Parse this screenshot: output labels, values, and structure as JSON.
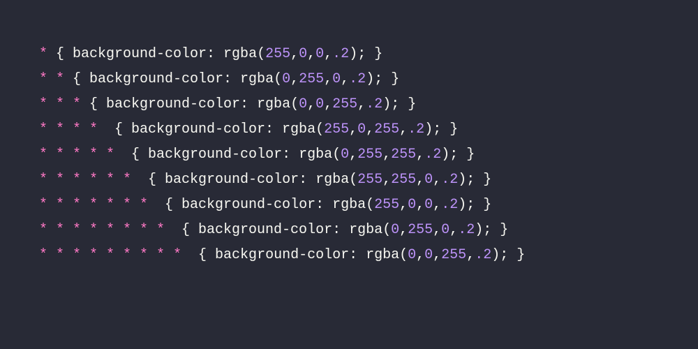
{
  "lines": [
    {
      "selector": "*",
      "property": "background-color",
      "func": "rgba",
      "args": [
        "255",
        "0",
        "0",
        ".2"
      ]
    },
    {
      "selector": "* *",
      "property": "background-color",
      "func": "rgba",
      "args": [
        "0",
        "255",
        "0",
        ".2"
      ]
    },
    {
      "selector": "* * *",
      "property": "background-color",
      "func": "rgba",
      "args": [
        "0",
        "0",
        "255",
        ".2"
      ]
    },
    {
      "selector": "* * * * ",
      "property": "background-color",
      "func": "rgba",
      "args": [
        "255",
        "0",
        "255",
        ".2"
      ]
    },
    {
      "selector": "* * * * * ",
      "property": "background-color",
      "func": "rgba",
      "args": [
        "0",
        "255",
        "255",
        ".2"
      ]
    },
    {
      "selector": "* * * * * * ",
      "property": "background-color",
      "func": "rgba",
      "args": [
        "255",
        "255",
        "0",
        ".2"
      ]
    },
    {
      "selector": "* * * * * * * ",
      "property": "background-color",
      "func": "rgba",
      "args": [
        "255",
        "0",
        "0",
        ".2"
      ]
    },
    {
      "selector": "* * * * * * * * ",
      "property": "background-color",
      "func": "rgba",
      "args": [
        "0",
        "255",
        "0",
        ".2"
      ]
    },
    {
      "selector": "* * * * * * * * * ",
      "property": "background-color",
      "func": "rgba",
      "args": [
        "0",
        "0",
        "255",
        ".2"
      ]
    }
  ]
}
